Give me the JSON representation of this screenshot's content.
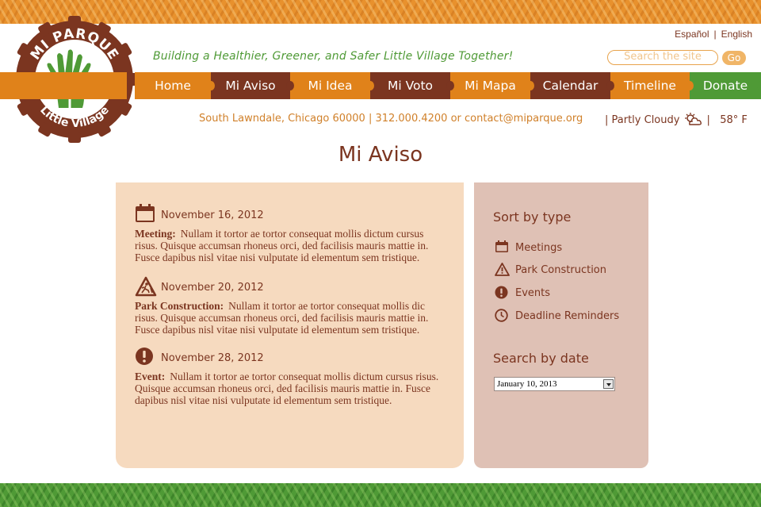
{
  "logo": {
    "top_text": "MI PARQUE",
    "bottom_text": "Little Village"
  },
  "lang": {
    "es": "Español",
    "sep": "|",
    "en": "English"
  },
  "tagline": "Building a Healthier, Greener, and Safer Little Village Together!",
  "search": {
    "placeholder": "Search the site",
    "button": "Go"
  },
  "nav": {
    "tabs": [
      "Home",
      "Mi Aviso",
      "Mi Idea",
      "Mi Voto",
      "Mi Mapa",
      "Calendar",
      "Timeline",
      "Donate"
    ]
  },
  "contact": {
    "text": "South Lawndale, Chicago 60000  |  312.000.4200  or  contact@miparque.org"
  },
  "weather": {
    "lead": "|  Partly Cloudy",
    "sep": "|",
    "temp": "58° F"
  },
  "page_title": "Mi Aviso",
  "notices": [
    {
      "date": "November 16, 2012",
      "type": "Meeting:",
      "text": "Nullam it tortor ae tortor consequat mollis dictum cursus risus. Quisque accumsan rhoneus orci, ded facilisis mauris mattie in. Fusce dapibus nisl vitae nisi vulputate id elementum sem tristique.",
      "icon": "calendar-icon"
    },
    {
      "date": "November 20, 2012",
      "type": "Park Construction:",
      "text": "Nullam it tortor ae tortor consequat mollis dic risus. Quisque accumsan rhoneus orci, ded facilisis mauris mattie in. Fusce dapibus nisl vitae nisi vulputate id elementum sem tristique.",
      "icon": "construction-icon"
    },
    {
      "date": "November 28, 2012",
      "type": "Event:",
      "text": "Nullam it tortor ae tortor consequat mollis dictum cursus risus. Quisque accumsan rhoneus orci, ded facilisis mauris mattie in. Fusce dapibus nisl vitae nisi vulputate id elementum sem tristique.",
      "icon": "exclamation-icon"
    }
  ],
  "sidebar": {
    "sort_title": "Sort by type",
    "sort_items": [
      {
        "label": "Meetings",
        "icon": "calendar-icon"
      },
      {
        "label": "Park Construction",
        "icon": "warning-icon"
      },
      {
        "label": "Events",
        "icon": "exclamation-icon"
      },
      {
        "label": "Deadline Reminders",
        "icon": "clock-icon"
      }
    ],
    "date_title": "Search by date",
    "date_value": "January 10, 2013"
  },
  "colors": {
    "orange": "#e0821a",
    "brown": "#7b3520",
    "green": "#4f9a36",
    "main_panel": "#f6dabf",
    "side_panel": "#dfc1b5"
  }
}
